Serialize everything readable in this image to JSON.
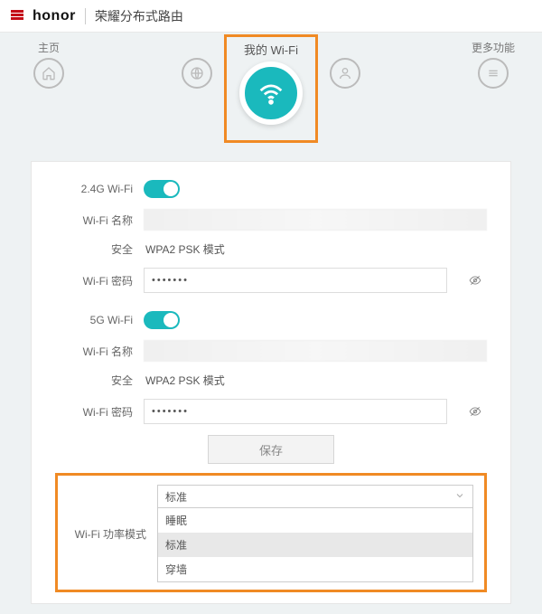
{
  "header": {
    "brand": "honor",
    "product": "荣耀分布式路由"
  },
  "nav": {
    "home": "主页",
    "wifi": "我的 Wi-Fi",
    "more": "更多功能"
  },
  "wifi24": {
    "section": "2.4G Wi-Fi",
    "name_label": "Wi-Fi 名称",
    "security_label": "安全",
    "security_value": "WPA2 PSK 模式",
    "password_label": "Wi-Fi 密码",
    "password_mask": "•••••••"
  },
  "wifi5": {
    "section": "5G Wi-Fi",
    "name_label": "Wi-Fi 名称",
    "security_label": "安全",
    "security_value": "WPA2 PSK 模式",
    "password_label": "Wi-Fi 密码",
    "password_mask": "•••••••"
  },
  "save_label": "保存",
  "power": {
    "label": "Wi-Fi 功率模式",
    "selected": "标准",
    "options": [
      "睡眠",
      "标准",
      "穿墙"
    ]
  }
}
